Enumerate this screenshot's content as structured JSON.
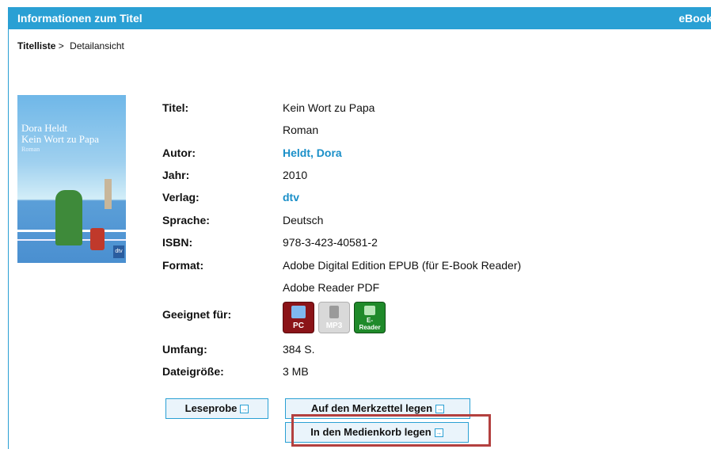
{
  "header": {
    "title": "Informationen zum Titel",
    "right": "eBook"
  },
  "breadcrumb": {
    "root": "Titelliste",
    "sep": " > ",
    "current": "Detailansicht"
  },
  "cover": {
    "author": "Dora Heldt",
    "title": "Kein Wort zu Papa",
    "subtitle": "Roman",
    "logo": "dtv"
  },
  "details": {
    "titel_label": "Titel:",
    "titel_value": "Kein Wort zu Papa",
    "titel_sub": "Roman",
    "autor_label": "Autor:",
    "autor_value": "Heldt, Dora",
    "jahr_label": "Jahr:",
    "jahr_value": "2010",
    "verlag_label": "Verlag:",
    "verlag_value": "dtv",
    "sprache_label": "Sprache:",
    "sprache_value": "Deutsch",
    "isbn_label": "ISBN:",
    "isbn_value": "978-3-423-40581-2",
    "format_label": "Format:",
    "format_value1": "Adobe Digital Edition EPUB (für E-Book Reader)",
    "format_value2": "Adobe Reader PDF",
    "geeignet_label": "Geeignet für:",
    "umfang_label": "Umfang:",
    "umfang_value": "384 S.",
    "dateigroesse_label": "Dateigröße:",
    "dateigroesse_value": "3 MB"
  },
  "devices": {
    "pc": "PC",
    "mp3": "MP3",
    "ereader_line1": "E-",
    "ereader_line2": "Reader"
  },
  "buttons": {
    "leseprobe": "Leseprobe",
    "merkzettel": "Auf den Merkzettel legen",
    "medienkorb": "In den Medienkorb legen",
    "arrow": "→"
  },
  "colors": {
    "accent": "#2aa0d4",
    "link": "#1a8fc8",
    "highlight": "#b3403f"
  }
}
